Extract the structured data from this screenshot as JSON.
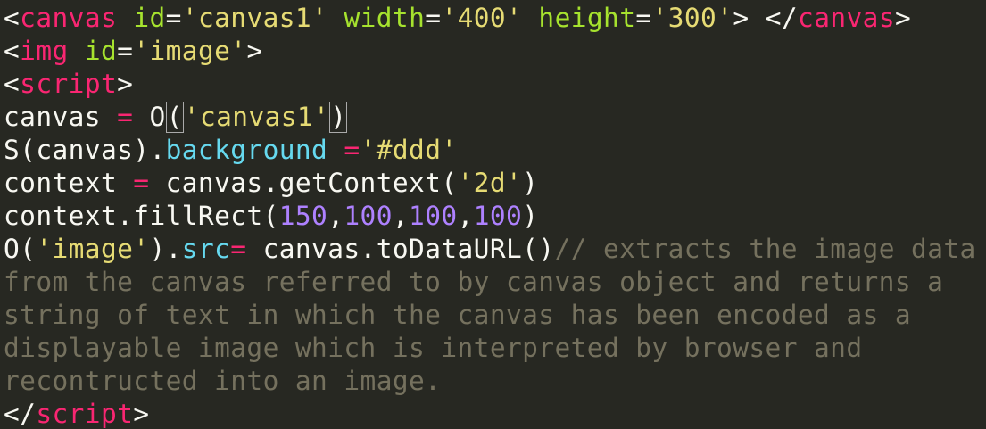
{
  "code": {
    "line1": {
      "lt": "<",
      "tag": "canvas",
      "sp1": " ",
      "attr_id": "id",
      "eq1": "=",
      "val_id": "'canvas1'",
      "sp2": " ",
      "attr_width": "width",
      "eq2": "=",
      "val_width": "'400'",
      "sp3": " ",
      "attr_height": "height",
      "eq3": "=",
      "val_height": "'300'",
      "gt": ">",
      "sp4": " ",
      "close_lt": "</",
      "close_tag": "canvas",
      "close_gt": ">"
    },
    "line2": {
      "lt": "<",
      "tag": "img",
      "sp": " ",
      "attr_id": "id",
      "eq": "=",
      "val_id": "'image'",
      "gt": ">"
    },
    "line3": {
      "lt": "<",
      "tag": "script",
      "gt": ">"
    },
    "line4": {
      "var": "canvas",
      "op": " = ",
      "fn_head": "O",
      "paren": "(",
      "str": "'canvas1'",
      "close": ")"
    },
    "line5": {
      "obj": "S(canvas).",
      "prop": "background",
      "op": " =",
      "str": "'#ddd'"
    },
    "line6": {
      "var": "context",
      "op": " = ",
      "call": "canvas.getContext(",
      "str": "'2d'",
      "close": ")"
    },
    "line7": {
      "call": "context.fillRect(",
      "n1": "150",
      "c1": ",",
      "n2": "100",
      "c2": ",",
      "n3": "100",
      "c3": ",",
      "n4": "100",
      "close": ")"
    },
    "line8": {
      "call": "O(",
      "str": "'image'",
      "mid": ").",
      "prop": "src",
      "op": "=",
      "rest": " canvas.toDataURL()",
      "comment": "// extracts the image data"
    },
    "line9": {
      "comment": "from the canvas referred to by canvas object and returns a"
    },
    "line10": {
      "comment": "string of text in which the canvas has been encoded as a"
    },
    "line11": {
      "comment": "displayable image which is interpreted by browser and"
    },
    "line12": {
      "comment": "recontructed into an image."
    },
    "line13": {
      "lt": "</",
      "tag": "script",
      "gt": ">"
    }
  },
  "colors": {
    "background": "#272822",
    "tag": "#f92672",
    "attribute": "#a6e22e",
    "string": "#e6db74",
    "operator": "#f92672",
    "property": "#66d9ef",
    "number": "#ae81ff",
    "comment": "#75715e",
    "plain": "#f8f8f2"
  }
}
